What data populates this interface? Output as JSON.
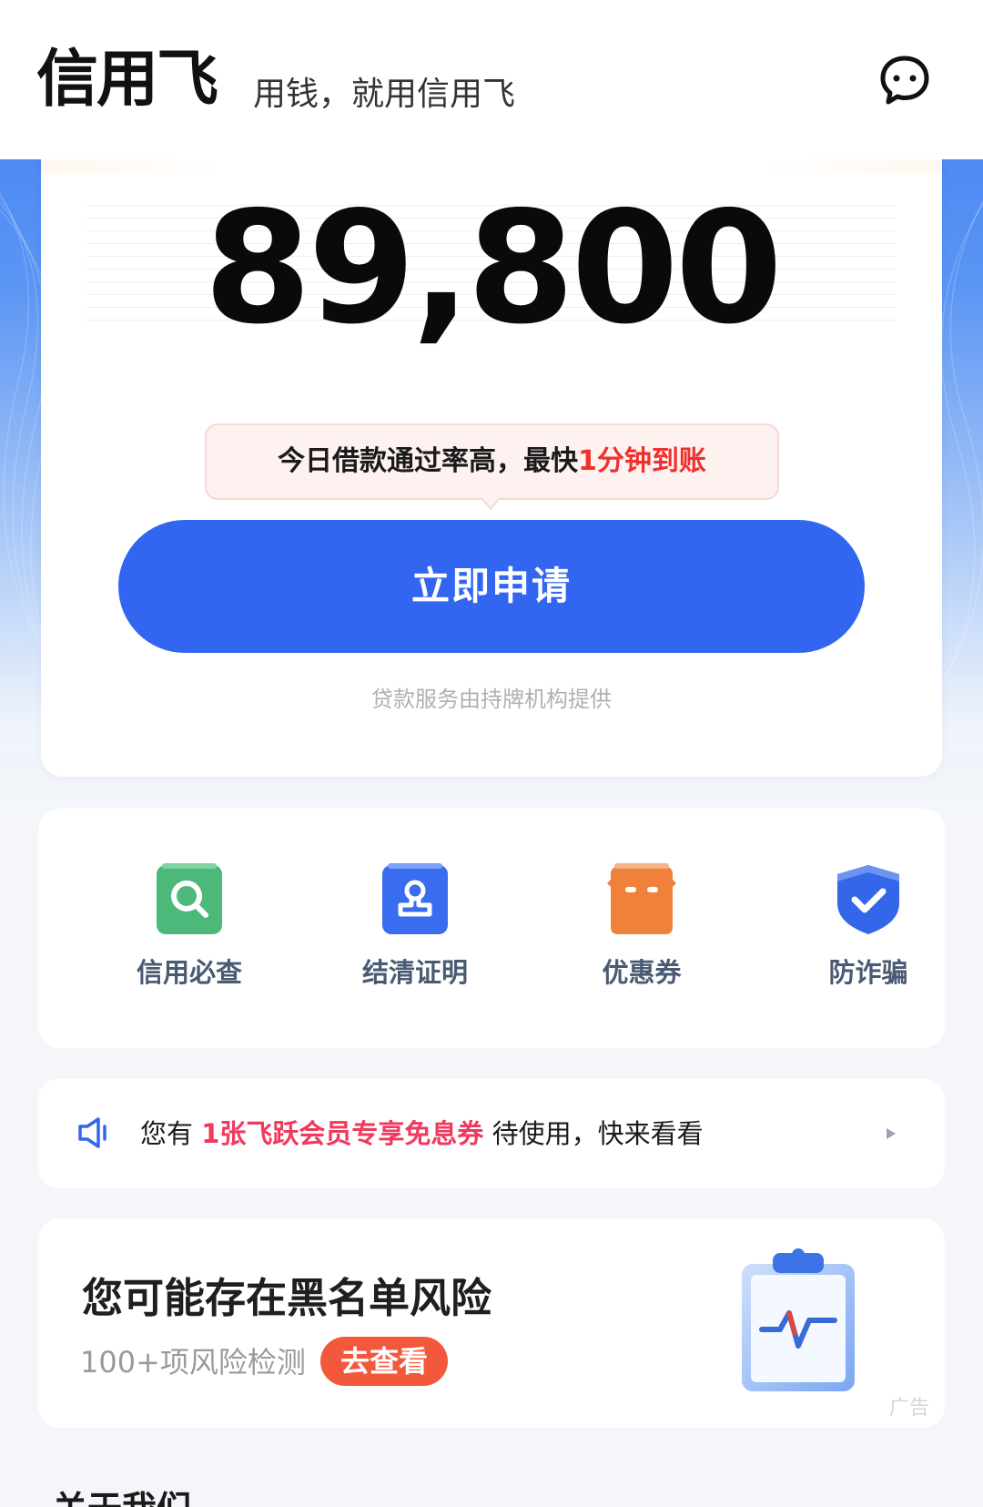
{
  "header": {
    "brand": "信用飞",
    "slogan": "用钱，就用信用飞",
    "message_icon": "chat-bubble-icon"
  },
  "loan_card": {
    "amount": "89,800",
    "tip_prefix": "今日借款通过率高，最快",
    "tip_highlight": "1分钟到账",
    "apply_label": "立即申请",
    "provider_note": "贷款服务由持牌机构提供"
  },
  "features": [
    {
      "label": "信用必查",
      "icon": "credit-search-icon",
      "color": "#4cb97a"
    },
    {
      "label": "结清证明",
      "icon": "stamp-icon",
      "color": "#3a6cf0"
    },
    {
      "label": "优惠券",
      "icon": "coupon-icon",
      "color": "#f0813a"
    },
    {
      "label": "防诈骗",
      "icon": "shield-check-icon",
      "color": "#3366e8"
    }
  ],
  "notice": {
    "prefix": "您有 ",
    "highlight": "1张飞跃会员专享免息券",
    "suffix": " 待使用，快来看看",
    "icon": "speaker-icon"
  },
  "ad": {
    "title": "您可能存在黑名单风险",
    "subtitle": "100+项风险检测",
    "button": "去查看",
    "tag": "广告",
    "icon": "clipboard-pulse-icon"
  },
  "about": {
    "title": "关于我们"
  },
  "colors": {
    "primary": "#3266f0",
    "highlight_red": "#f0302c",
    "highlight_pink": "#ef3a5d",
    "ad_button": "#f2593c"
  }
}
